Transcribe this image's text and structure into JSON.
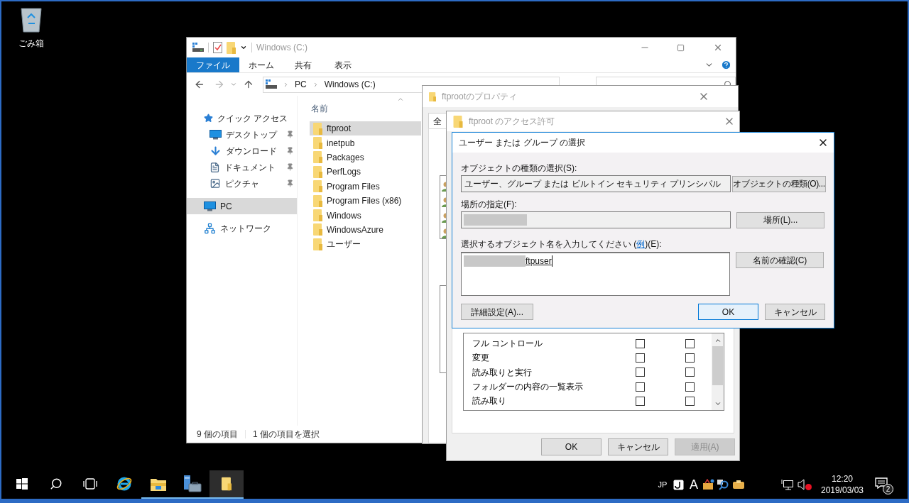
{
  "desktop": {
    "icons": [
      {
        "label": "ごみ箱"
      }
    ]
  },
  "explorer": {
    "title": "Windows (C:)",
    "ribbon_tabs": [
      {
        "label": "ファイル",
        "selected": true
      },
      {
        "label": "ホーム",
        "selected": false
      },
      {
        "label": "共有",
        "selected": false
      },
      {
        "label": "表示",
        "selected": false
      }
    ],
    "breadcrumb": [
      "PC",
      "Windows (C:)"
    ],
    "nav_tree": [
      {
        "label": "クイック アクセス",
        "kind": "quick-access",
        "selected": false,
        "pinned": false,
        "children": [
          {
            "label": "デスクトップ",
            "kind": "desktop",
            "selected": false,
            "pinned": true
          },
          {
            "label": "ダウンロード",
            "kind": "downloads",
            "selected": false,
            "pinned": true
          },
          {
            "label": "ドキュメント",
            "kind": "documents",
            "selected": false,
            "pinned": true
          },
          {
            "label": "ピクチャ",
            "kind": "pictures",
            "selected": false,
            "pinned": true
          }
        ]
      },
      {
        "label": "PC",
        "kind": "pc",
        "selected": true,
        "pinned": false
      },
      {
        "label": "ネットワーク",
        "kind": "network",
        "selected": false,
        "pinned": false
      }
    ],
    "column_header": "名前",
    "files": [
      {
        "name": "ftproot",
        "selected": true
      },
      {
        "name": "inetpub",
        "selected": false
      },
      {
        "name": "Packages",
        "selected": false
      },
      {
        "name": "PerfLogs",
        "selected": false
      },
      {
        "name": "Program Files",
        "selected": false
      },
      {
        "name": "Program Files (x86)",
        "selected": false
      },
      {
        "name": "Windows",
        "selected": false
      },
      {
        "name": "WindowsAzure",
        "selected": false
      },
      {
        "name": "ユーザー",
        "selected": false
      }
    ],
    "status": [
      "9 個の項目",
      "1 個の項目を選択"
    ]
  },
  "properties": {
    "title": "ftprootのプロパティ",
    "tab": "全",
    "fragments": [
      {
        "kind": "user-list"
      },
      {
        "kind": "list"
      }
    ]
  },
  "permissions": {
    "title": "ftproot のアクセス許可",
    "rows": [
      {
        "label": "フル コントロール",
        "allow": false,
        "deny": false
      },
      {
        "label": "変更",
        "allow": false,
        "deny": false
      },
      {
        "label": "読み取りと実行",
        "allow": false,
        "deny": false
      },
      {
        "label": "フォルダーの内容の一覧表示",
        "allow": false,
        "deny": false
      },
      {
        "label": "読み取り",
        "allow": false,
        "deny": false
      }
    ],
    "buttons": [
      {
        "label": "OK",
        "disabled": false
      },
      {
        "label": "キャンセル",
        "disabled": false
      },
      {
        "label": "適用(A)",
        "disabled": true
      }
    ]
  },
  "select_dialog": {
    "title": "ユーザー または グループ の選択",
    "object_type": {
      "label": "オブジェクトの種類の選択(S):",
      "value": "ユーザー、グループ または ビルトイン セキュリティ プリンシパル",
      "button": "オブジェクトの種類(O)..."
    },
    "location": {
      "label": "場所の指定(F):",
      "redacted": true,
      "button": "場所(L)..."
    },
    "names": {
      "label_before": "選択するオブジェクト名を入力してください (",
      "link": "例",
      "label_after": ")(E):",
      "redacted": true,
      "value": "ftpuser",
      "resolved": true,
      "button": "名前の確認(C)"
    },
    "buttons": [
      {
        "label": "詳細設定(A)...",
        "default": false
      },
      {
        "label": "OK",
        "default": true
      },
      {
        "label": "キャンセル",
        "default": false
      }
    ]
  },
  "taskbar": {
    "buttons": [
      {
        "kind": "start",
        "running": false,
        "active": false
      },
      {
        "kind": "search",
        "running": false,
        "active": false
      },
      {
        "kind": "task-view",
        "running": false,
        "active": false
      },
      {
        "kind": "ie",
        "running": false,
        "active": false
      },
      {
        "kind": "explorer",
        "running": true,
        "active": false
      },
      {
        "kind": "server-manager",
        "running": true,
        "active": false
      },
      {
        "kind": "folder",
        "running": true,
        "active": true
      }
    ],
    "tray": {
      "ime_language": "JP",
      "ime_mode": "A",
      "muted": true,
      "time": "12:20",
      "date": "2019/03/03",
      "notifications": "2"
    }
  }
}
